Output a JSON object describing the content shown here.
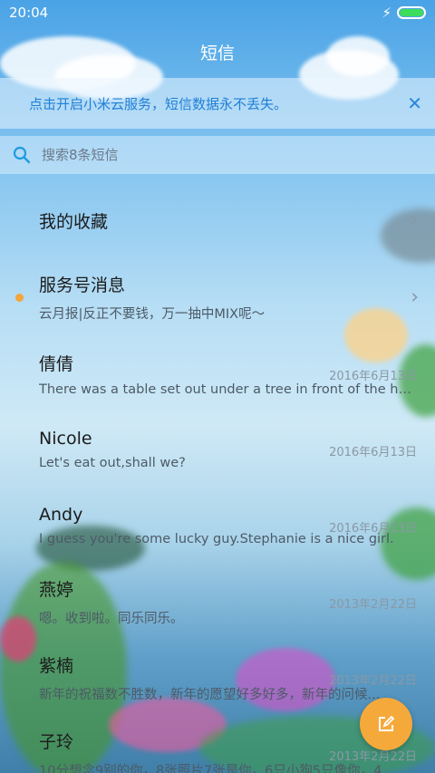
{
  "status_bar": {
    "time": "20:04",
    "battery_level": 1.0
  },
  "header": {
    "title": "短信"
  },
  "banner": {
    "text": "点击开启小米云服务，短信数据永不丢失。",
    "close_label": "✕"
  },
  "search": {
    "placeholder": "搜索8条短信"
  },
  "favorites": {
    "label": "我的收藏"
  },
  "service": {
    "name": "服务号消息",
    "preview": "云月报|反正不要钱，万一抽中MIX呢～"
  },
  "conversations": [
    {
      "name": "倩倩",
      "date": "2016年6月13日",
      "preview": "There was a table set out under a tree in front of the house..."
    },
    {
      "name": "Nicole",
      "date": "2016年6月13日",
      "preview": "Let's eat out,shall we?"
    },
    {
      "name": "Andy",
      "date": "2016年6月13日",
      "preview": "I guess you're some lucky guy.Stephanie is a nice girl."
    },
    {
      "name": "燕婷",
      "date": "2013年2月22日",
      "preview": "嗯。收到啦。同乐同乐。"
    },
    {
      "name": "紫楠",
      "date": "2013年2月22日",
      "preview": "新年的祝福数不胜数，新年的愿望好多好多，新年的问候..."
    },
    {
      "name": "子玲",
      "date": "2013年2月22日",
      "preview": "10分想念9别的你，8张照片7张是你，6只小狗5只像你，4..."
    }
  ],
  "colors": {
    "accent": "#1f7fd6",
    "fab": "#f6a93b",
    "unread": "#f5a53a"
  },
  "icons": {
    "search": "search-icon",
    "compose": "compose-icon",
    "chevron": "chevron-right-icon",
    "close": "close-icon"
  }
}
